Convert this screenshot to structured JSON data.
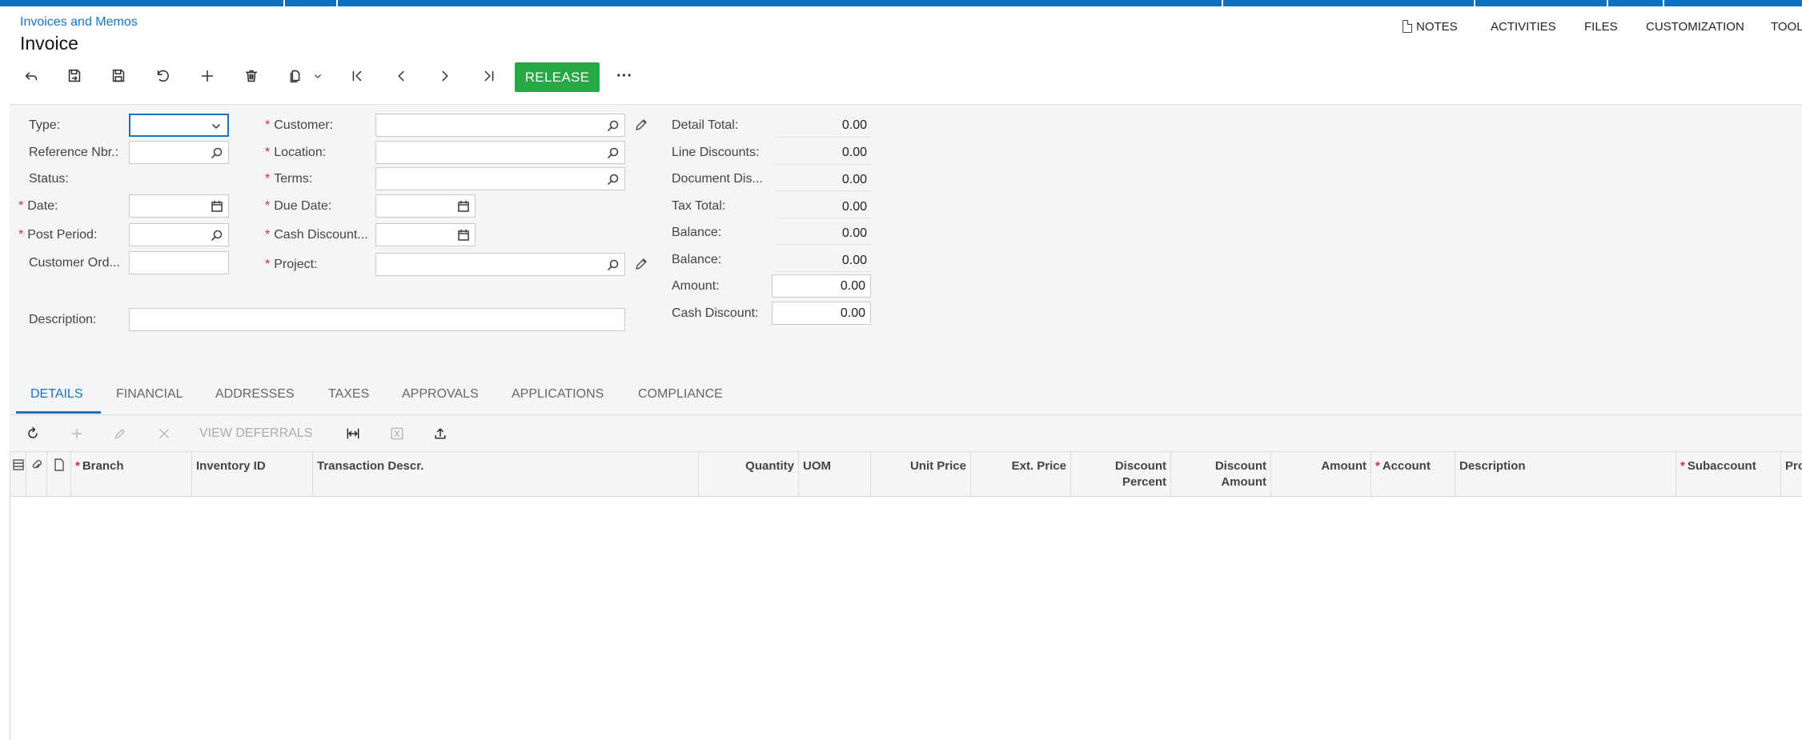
{
  "breadcrumb": "Invoices and Memos",
  "title": "Invoice",
  "top_links": [
    {
      "label": "NOTES",
      "icon": "note-icon"
    },
    {
      "label": "ACTIVITIES"
    },
    {
      "label": "FILES"
    },
    {
      "label": "CUSTOMIZATION"
    },
    {
      "label": "TOOL"
    }
  ],
  "toolbar": {
    "release_label": "RELEASE",
    "more_label": "···"
  },
  "form": {
    "type_label": "Type:",
    "ref_label": "Reference Nbr.:",
    "status_label": "Status:",
    "date_label": "Date:",
    "post_period_label": "Post Period:",
    "customer_ord_label": "Customer Ord...",
    "description_label": "Description:",
    "customer_label": "Customer:",
    "location_label": "Location:",
    "terms_label": "Terms:",
    "due_date_label": "Due Date:",
    "cash_discount_date_label": "Cash Discount...",
    "project_label": "Project:",
    "required_mark": "*"
  },
  "totals": [
    {
      "label": "Detail Total:",
      "value": "0.00"
    },
    {
      "label": "Line Discounts:",
      "value": "0.00"
    },
    {
      "label": "Document Dis...",
      "value": "0.00"
    },
    {
      "label": "Tax Total:",
      "value": "0.00"
    },
    {
      "label": "Balance:",
      "value": "0.00"
    },
    {
      "label": "Balance:",
      "value": "0.00"
    },
    {
      "label": "Amount:",
      "value": "0.00"
    },
    {
      "label": "Cash Discount:",
      "value": "0.00"
    }
  ],
  "tabs": [
    "DETAILS",
    "FINANCIAL",
    "ADDRESSES",
    "TAXES",
    "APPROVALS",
    "APPLICATIONS",
    "COMPLIANCE"
  ],
  "active_tab": "DETAILS",
  "grid_toolbar": {
    "view_deferrals": "VIEW DEFERRALS"
  },
  "columns": [
    {
      "label": "Branch",
      "required": true
    },
    {
      "label": "Inventory ID"
    },
    {
      "label": "Transaction Descr."
    },
    {
      "label": "Quantity"
    },
    {
      "label": "UOM"
    },
    {
      "label": "Unit Price"
    },
    {
      "label": "Ext. Price"
    },
    {
      "label": "Discount Percent"
    },
    {
      "label": "Discount Amount"
    },
    {
      "label": "Amount"
    },
    {
      "label": "Account",
      "required": true
    },
    {
      "label": "Description"
    },
    {
      "label": "Subaccount",
      "required": true
    },
    {
      "label": "Pro"
    }
  ],
  "colors": {
    "topbar": "#0e72c2",
    "accent": "#1a73c2",
    "release": "#28a745",
    "required": "#d32f2f"
  }
}
